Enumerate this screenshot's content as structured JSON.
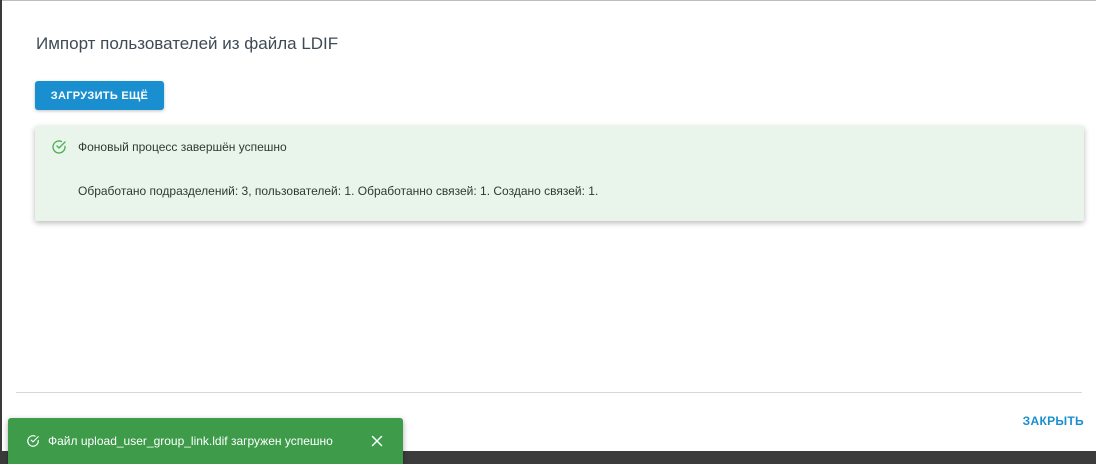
{
  "dialog": {
    "title": "Импорт пользователей из файла LDIF",
    "upload_more_label": "ЗАГРУЗИТЬ ЕЩЁ",
    "close_label": "ЗАКРЫТЬ"
  },
  "alert": {
    "icon": "check-circle-icon",
    "title": "Фоновый процесс завершён успешно",
    "message": "Обработано подразделений: 3, пользователей: 1. Обработанно связей: 1. Создано связей: 1."
  },
  "snackbar": {
    "icon": "check-circle-icon",
    "message": "Файл upload_user_group_link.ldif загружен успешно",
    "close_icon": "close-icon"
  },
  "colors": {
    "primary": "#1a8fd0",
    "success_bg": "#e9f4ea",
    "snackbar_bg": "#3d9b4a"
  }
}
